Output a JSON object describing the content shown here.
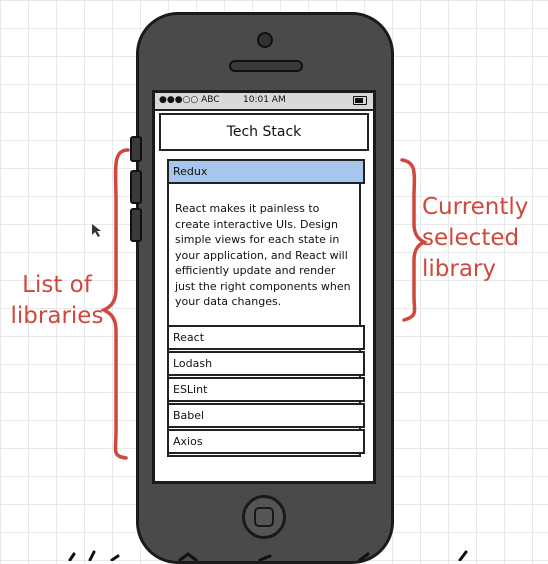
{
  "status_bar": {
    "carrier": "●●●○○ ABC",
    "time": "10:01 AM"
  },
  "header": {
    "title": "Tech Stack"
  },
  "selected_library": {
    "name": "Redux",
    "description": "React makes it painless to\ncreate interactive UIs. Design\nsimple views for each state in\nyour application, and React will\nefficiently update and render\njust the right components when\nyour data changes."
  },
  "libraries": [
    "React",
    "Lodash",
    "ESLint",
    "Babel",
    "Axios"
  ],
  "annotations": {
    "left": "List of\nlibraries",
    "right": "Currently\nselected\nlibrary",
    "color": "#d0473d"
  }
}
